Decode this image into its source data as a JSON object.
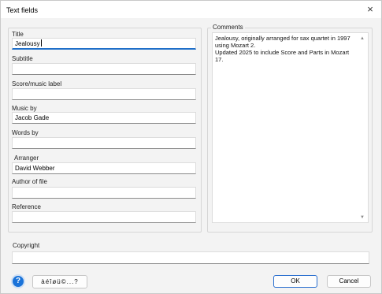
{
  "window": {
    "title": "Text fields",
    "close_glyph": "×"
  },
  "groups": {
    "comments_label": "Comments"
  },
  "fields": [
    {
      "label": "Title",
      "value": "Jealousy"
    },
    {
      "label": "Subtitle",
      "value": ""
    },
    {
      "label": "Score/music label",
      "value": ""
    },
    {
      "label": "Music by",
      "value": "Jacob Gade"
    },
    {
      "label": "Words by",
      "value": ""
    },
    {
      "label": "Arranger",
      "value": "David Webber"
    },
    {
      "label": "Author of file",
      "value": ""
    },
    {
      "label": "Reference",
      "value": ""
    }
  ],
  "comments": {
    "value": "Jealousy, originally arranged for sax quartet in 1997 using Mozart 2.\nUpdated 2025 to include Score and Parts in Mozart 17."
  },
  "copyright": {
    "label": "Copyright",
    "value": ""
  },
  "footer": {
    "help_glyph": "?",
    "special_chars_label": "àéîøü©...?",
    "ok_label": "OK",
    "cancel_label": "Cancel"
  },
  "icons": {
    "help": "help-icon",
    "close": "close-icon",
    "scroll_up": "scroll-up-arrow-icon",
    "scroll_down": "scroll-down-arrow-icon"
  },
  "colors": {
    "accent": "#1f6fc9",
    "help_button": "#1a73d9",
    "dialog_bg": "#f3f3f3"
  }
}
